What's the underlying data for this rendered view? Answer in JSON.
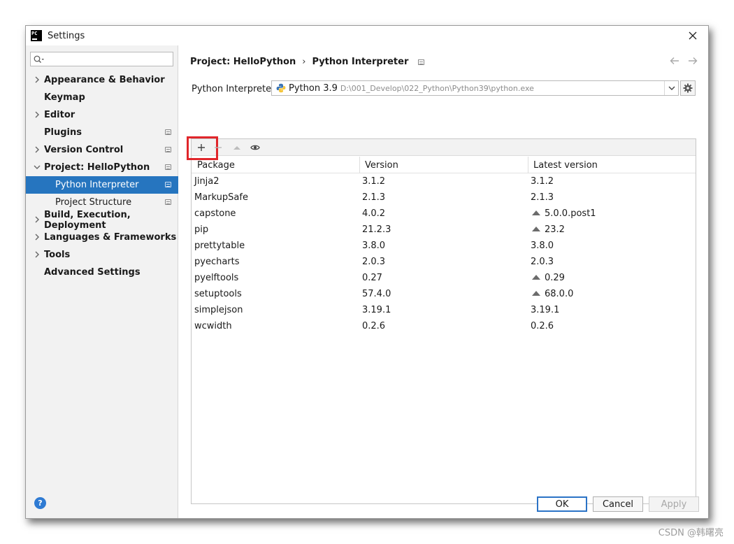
{
  "window": {
    "title": "Settings",
    "logo_text": "PC"
  },
  "search": {
    "value": ""
  },
  "sidebar": {
    "items": [
      {
        "label": "Appearance & Behavior"
      },
      {
        "label": "Keymap"
      },
      {
        "label": "Editor"
      },
      {
        "label": "Plugins"
      },
      {
        "label": "Version Control"
      },
      {
        "label": "Project: HelloPython"
      },
      {
        "label": "Python Interpreter"
      },
      {
        "label": "Project Structure"
      },
      {
        "label": "Build, Execution, Deployment"
      },
      {
        "label": "Languages & Frameworks"
      },
      {
        "label": "Tools"
      },
      {
        "label": "Advanced Settings"
      }
    ]
  },
  "breadcrumb": {
    "parent": "Project: HelloPython",
    "sep": "›",
    "current": "Python Interpreter"
  },
  "interpreter": {
    "label": "Python Interpreter:",
    "name": "Python 3.9",
    "path": "D:\\001_Develop\\022_Python\\Python39\\python.exe"
  },
  "packages": {
    "columns": [
      "Package",
      "Version",
      "Latest version"
    ],
    "rows": [
      {
        "name": "Jinja2",
        "version": "3.1.2",
        "latest": "3.1.2",
        "upgrade": false
      },
      {
        "name": "MarkupSafe",
        "version": "2.1.3",
        "latest": "2.1.3",
        "upgrade": false
      },
      {
        "name": "capstone",
        "version": "4.0.2",
        "latest": "5.0.0.post1",
        "upgrade": true
      },
      {
        "name": "pip",
        "version": "21.2.3",
        "latest": "23.2",
        "upgrade": true
      },
      {
        "name": "prettytable",
        "version": "3.8.0",
        "latest": "3.8.0",
        "upgrade": false
      },
      {
        "name": "pyecharts",
        "version": "2.0.3",
        "latest": "2.0.3",
        "upgrade": false
      },
      {
        "name": "pyelftools",
        "version": "0.27",
        "latest": "0.29",
        "upgrade": true
      },
      {
        "name": "setuptools",
        "version": "57.4.0",
        "latest": "68.0.0",
        "upgrade": true
      },
      {
        "name": "simplejson",
        "version": "3.19.1",
        "latest": "3.19.1",
        "upgrade": false
      },
      {
        "name": "wcwidth",
        "version": "0.2.6",
        "latest": "0.2.6",
        "upgrade": false
      }
    ]
  },
  "buttons": {
    "ok": "OK",
    "cancel": "Cancel",
    "apply": "Apply",
    "help": "?"
  },
  "watermark": "CSDN @韩曙亮",
  "colors": {
    "selection": "#2675bf",
    "highlight": "#e0262b",
    "ok_border": "#2b73c6"
  }
}
